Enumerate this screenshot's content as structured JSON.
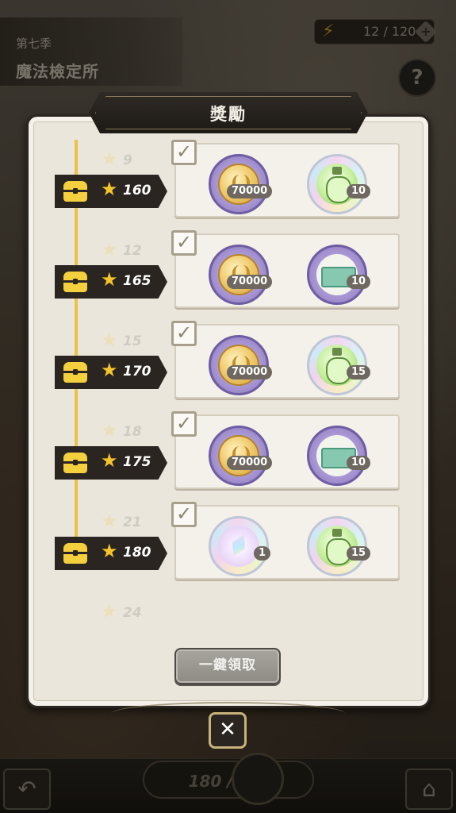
{
  "background": {
    "season_label": "第七季",
    "season_title": "魔法檢定所",
    "energy": "12 / 120",
    "energy_plus": "+",
    "help": "?",
    "progress": "180 / 189"
  },
  "panel": {
    "title": "獎勵",
    "claim_all_label": "一鍵領取",
    "close_label": "✕"
  },
  "rows": [
    {
      "stars": "160",
      "items": [
        {
          "kind": "coin",
          "qty": "70000"
        },
        {
          "kind": "potion",
          "qty": "10"
        }
      ]
    },
    {
      "stars": "165",
      "items": [
        {
          "kind": "coin",
          "qty": "70000"
        },
        {
          "kind": "ticket",
          "qty": "10"
        }
      ]
    },
    {
      "stars": "170",
      "items": [
        {
          "kind": "coin",
          "qty": "70000"
        },
        {
          "kind": "potion",
          "qty": "15"
        }
      ]
    },
    {
      "stars": "175",
      "items": [
        {
          "kind": "coin",
          "qty": "70000"
        },
        {
          "kind": "ticket",
          "qty": "10"
        }
      ]
    },
    {
      "stars": "180",
      "items": [
        {
          "kind": "crystal",
          "qty": "1"
        },
        {
          "kind": "potion",
          "qty": "15"
        }
      ]
    }
  ],
  "ghost_rows": [
    {
      "stars": "9"
    },
    {
      "stars": "12"
    },
    {
      "stars": "15"
    },
    {
      "stars": "18"
    },
    {
      "stars": "21"
    },
    {
      "stars": "24"
    }
  ],
  "icons": {
    "chest": "chest-icon",
    "star": "★",
    "check": "✓",
    "energy": "⚡",
    "back": "↶",
    "home": "⌂"
  },
  "colors": {
    "panel_bg": "#ebe6dc",
    "tag_bg": "#2a2520",
    "gold": "#f4cf3e",
    "timeline": "#e8c349"
  }
}
